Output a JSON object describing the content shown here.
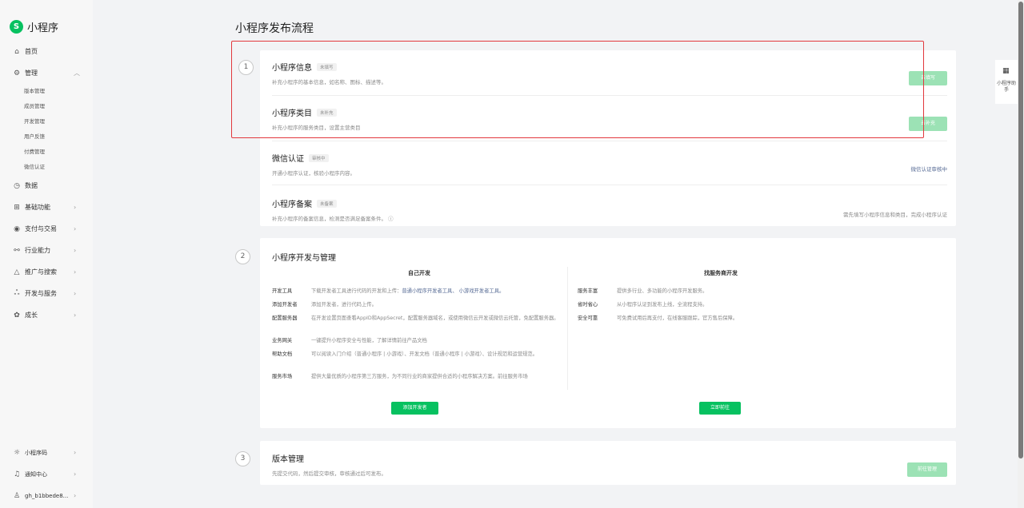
{
  "app": {
    "name": "小程序"
  },
  "nav": {
    "home": "首页",
    "manage": "管理",
    "manage_sub": [
      "版本管理",
      "成员管理",
      "开发管理",
      "用户反馈",
      "付费管理",
      "微信认证"
    ],
    "data": "数据",
    "basic": "基础功能",
    "payment": "支付与交易",
    "industry": "行业能力",
    "promo": "推广与搜索",
    "dev_service": "开发与服务",
    "growth": "成长"
  },
  "bottom_nav": {
    "code": "小程序码",
    "notify": "通知中心",
    "account": "gh_b1bbede8..."
  },
  "page": {
    "title": "小程序发布流程"
  },
  "step1": {
    "num": "1",
    "rows": [
      {
        "title": "小程序信息",
        "badge": "未填写",
        "desc": "补充小程序的基本信息，如名称、图标、描述等。",
        "action": "去填写"
      },
      {
        "title": "小程序类目",
        "badge": "未补充",
        "desc": "补充小程序的服务类目，设置主营类目",
        "action": "去补充"
      },
      {
        "title": "微信认证",
        "badge": "审核中",
        "desc": "开通小程序认证，核验小程序内容。",
        "action": "微信认证审核中"
      },
      {
        "title": "小程序备案",
        "badge": "未备案",
        "desc": "补充小程序的备案信息，检测是否满足备案条件。 ⓘ",
        "action": "需先填写小程序信息和类目，完成小程序认证"
      }
    ]
  },
  "step2": {
    "num": "2",
    "title": "小程序开发与管理",
    "self": {
      "title": "自己开发",
      "rows": [
        {
          "label": "开发工具",
          "text": "下载开发者工具进行代码的开发和上传：",
          "link": "普通小程序开发者工具、 小游戏开发者工具。"
        },
        {
          "label": "添加开发者",
          "text": "添加开发者，进行代码上传。",
          "link": ""
        },
        {
          "label": "配置服务器",
          "text": "在开发设置页面查看AppID和AppSecret，配置服务器域名，或使用微信云开发或微信云托管，免配置服务器。",
          "link": ""
        },
        {
          "label": "业务网关",
          "text": "一键提升小程序安全与性能，了解详情前往产品文档",
          "link": ""
        },
        {
          "label": "帮助文档",
          "text": "可以阅读入门介绍（普通小程序 | 小游戏）、开发文档（普通小程序 | 小游戏）、设计规范和运营规范。",
          "link": ""
        },
        {
          "label": "服务市场",
          "text": "提供大量优质的小程序第三方服务，为不同行业的商家提供合适的小程序解决方案。前往服务市场",
          "link": ""
        }
      ],
      "button": "添加开发者"
    },
    "provider": {
      "title": "找服务商开发",
      "rows": [
        {
          "label": "服务丰富",
          "text": "提供多行业、多功能的小程序开发服务。"
        },
        {
          "label": "省时省心",
          "text": "从小程序认证到发布上线，全流程支持。"
        },
        {
          "label": "安全可靠",
          "text": "可免费试用后再支付，在线客服跟踪，官方售后保障。"
        }
      ],
      "button": "立即前往"
    }
  },
  "step3": {
    "num": "3",
    "title": "版本管理",
    "desc": "先提交代码，然后提交审核，审核通过后可发布。",
    "action": "前往管理"
  },
  "assistant": {
    "label": "小程序助手"
  }
}
